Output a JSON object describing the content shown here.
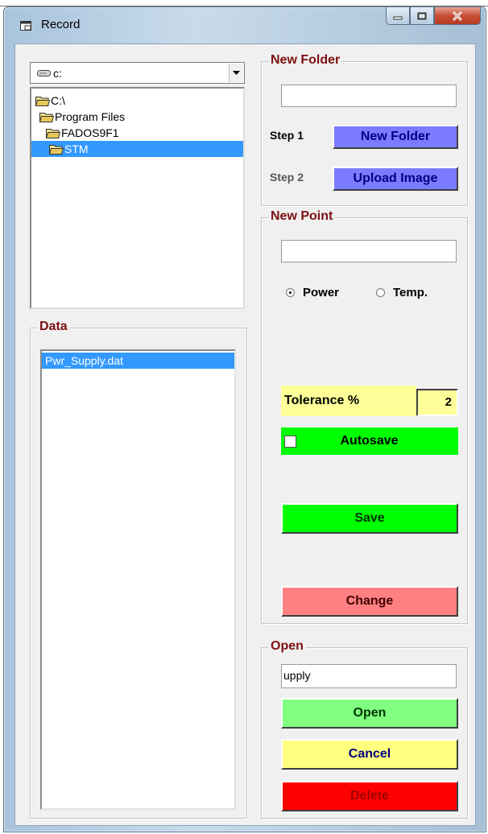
{
  "window": {
    "title": "Record",
    "minimize_icon": "minimize-icon",
    "maximize_icon": "maximize-icon",
    "close_icon": "close-icon"
  },
  "drive": {
    "value": "c:",
    "icon": "drive-icon"
  },
  "directories": [
    {
      "label": "C:\\",
      "selected": false
    },
    {
      "label": "Program Files",
      "selected": false
    },
    {
      "label": "FADOS9F1",
      "selected": false
    },
    {
      "label": "STM",
      "selected": true
    }
  ],
  "data_group": {
    "title": "Data",
    "files": [
      {
        "label": "Pwr_Supply.dat",
        "selected": true
      }
    ]
  },
  "new_folder_group": {
    "title": "New Folder",
    "input_value": "",
    "step1_label": "Step 1",
    "step1_button": "New Folder",
    "step2_label": "Step 2",
    "step2_button": "Upload Image"
  },
  "new_point_group": {
    "title": "New Point",
    "input_value": "",
    "radio_power": "Power",
    "radio_temp": "Temp.",
    "selected_radio": "Power",
    "tolerance_label": "Tolerance %",
    "tolerance_value": "2",
    "autosave_label": "Autosave",
    "autosave_checked": false,
    "save_button": "Save",
    "change_button": "Change"
  },
  "open_group": {
    "title": "Open",
    "input_value": "upply",
    "open_button": "Open",
    "cancel_button": "Cancel",
    "delete_button": "Delete"
  },
  "colors": {
    "group_title": "#7c1010",
    "step_button": "#7b7bff",
    "green": "#00ff00",
    "light_green": "#80ff80",
    "red_light": "#ff8080",
    "yellow": "#ffff80",
    "red": "#ff0000",
    "selection": "#3399ff"
  }
}
